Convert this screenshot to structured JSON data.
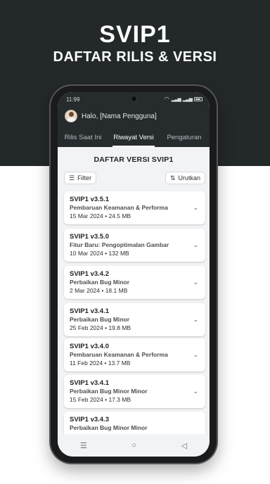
{
  "hero": {
    "title": "SVIP1",
    "subtitle": "DAFTAR RILIS & VERSI"
  },
  "statusbar": {
    "time": "11:99",
    "network": "full"
  },
  "header": {
    "greeting": "Halo, [Nama Pengguna]"
  },
  "tabs": [
    {
      "label": "Rilis Saat Ini",
      "active": false
    },
    {
      "label": "Riwayat Versi",
      "active": true
    },
    {
      "label": "Pengaturan",
      "active": false
    }
  ],
  "main": {
    "title": "DAFTAR VERSI SVIP1",
    "filter_label": "Filter",
    "sort_label": "Urutkan"
  },
  "versions": [
    {
      "version": "SVIP1 v3.5.1",
      "description": "Pembaruan Keamanan & Performa",
      "date": "15 Mar 2024",
      "size": "24.5 MB"
    },
    {
      "version": "SVIP1 v3.5.0",
      "description": "Fitur Baru: Pengoptimalan Gambar",
      "date": "10 Mar 2024",
      "size": "132 MB"
    },
    {
      "version": "SVIP1 v3.4.2",
      "description": "Perbaikan Bug Minor",
      "date": "2 Mar 2024",
      "size": "18.1 MB"
    },
    {
      "version": "SVIP1 v3.4.1",
      "description": "Perbaikan Bug Minor",
      "date": "25 Feb 2024",
      "size": "19.8 MB"
    },
    {
      "version": "SVIP1 v3.4.0",
      "description": "Pembaruan Keamanan & Performa",
      "date": "11 Feb 2024",
      "size": "13.7 MB"
    },
    {
      "version": "SVIP1 v3.4.1",
      "description": "Perbaikan Bug Minor Minor",
      "date": "15 Feb 2024",
      "size": "17.3 MB"
    },
    {
      "version": "SVIP1 v3.4.3",
      "description": "Perbaikan Bug Minor Minor",
      "date": "",
      "size": ""
    }
  ],
  "colors": {
    "hero_background": "#232829",
    "app_bar": "#262b2e",
    "content_background": "#f2f3f5"
  }
}
